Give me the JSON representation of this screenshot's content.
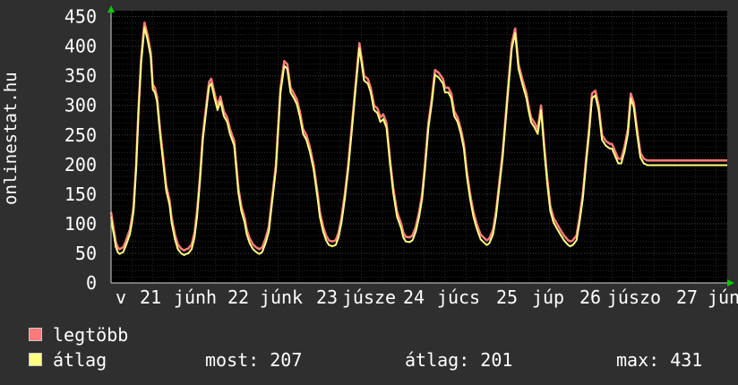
{
  "ylabel": "onlinestat.hu",
  "colors": {
    "background": "#2f2f2f",
    "plot": "#000000",
    "grid": "#5a5a5a",
    "max": "#ff7a7a",
    "avg": "#ffff80",
    "axis_arrow": "#00cc00"
  },
  "legend": {
    "max_label": "legtöbb",
    "avg_label": "átlag"
  },
  "stats": {
    "now": "most: 207",
    "avg": "átlag: 201",
    "max": "max: 431"
  },
  "chart_data": {
    "type": "line",
    "ylim": [
      0,
      460
    ],
    "yticks": [
      0,
      50,
      100,
      150,
      200,
      250,
      300,
      350,
      400,
      450
    ],
    "x_tick_labels": [
      "v",
      "21",
      "júnh",
      "22",
      "júnk",
      "23",
      "júsze",
      "24",
      "júcs",
      "25",
      "júp",
      "26",
      "júszo",
      "27",
      "jún"
    ],
    "series": [
      {
        "name": "legtöbb",
        "color": "#ff7a7a",
        "x": [
          0,
          0.04,
          0.09,
          0.11,
          0.16,
          0.2,
          0.29,
          0.35,
          0.45,
          0.5,
          0.54,
          0.6,
          0.66,
          0.72,
          0.8,
          0.87,
          0.95,
          1.0,
          1.05,
          1.1,
          1.18,
          1.25,
          1.32,
          1.4,
          1.45,
          1.53,
          1.6,
          1.68,
          1.75,
          1.8,
          1.85,
          1.93,
          2.0,
          2.06,
          2.13,
          2.2,
          2.28,
          2.35,
          2.4,
          2.48,
          2.55,
          2.62,
          2.7,
          2.78,
          2.85,
          2.95,
          3.0,
          3.05,
          3.12,
          3.2,
          3.25,
          3.32,
          3.4,
          3.48,
          3.55,
          3.62,
          3.7,
          3.78,
          3.85,
          3.95,
          4.0,
          4.06,
          4.15,
          4.22,
          4.3,
          4.38,
          4.45,
          4.52,
          4.6,
          4.68,
          4.76,
          4.85,
          4.95,
          5.0,
          5.08,
          5.15,
          5.22,
          5.3,
          5.38,
          5.45,
          5.52,
          5.6,
          5.68,
          5.76,
          5.85,
          5.95,
          6.0,
          6.06,
          6.15,
          6.22,
          6.3,
          6.38,
          6.45,
          6.52,
          6.6,
          6.68,
          6.76,
          6.85,
          6.95,
          7.0,
          7.06,
          7.15,
          7.22,
          7.3,
          7.38,
          7.45,
          7.52,
          7.6,
          7.68,
          7.76,
          7.85,
          7.95,
          8.0,
          8.08,
          8.15,
          8.22,
          8.3,
          8.38,
          8.45,
          8.52,
          8.6,
          8.68,
          8.76,
          8.85,
          8.95,
          9.0,
          9.06,
          9.15,
          9.22,
          9.3,
          9.38,
          9.45,
          9.52,
          9.6,
          9.68,
          9.76,
          9.85,
          9.95,
          10.0,
          10.06,
          10.15,
          10.22,
          10.3,
          10.38,
          10.45,
          10.52,
          10.6,
          10.68,
          10.76,
          10.85,
          10.95,
          11.0,
          11.06,
          11.15,
          11.22,
          11.3,
          11.38,
          11.45,
          11.52,
          11.6,
          11.68,
          11.76,
          11.85,
          11.95,
          12.0,
          12.06,
          12.15,
          12.22,
          12.3,
          12.38,
          12.45,
          12.52,
          12.6,
          12.68,
          12.76,
          12.85,
          12.95,
          13.0,
          13.06,
          13.15,
          13.22,
          13.3,
          13.38,
          13.45,
          13.52,
          13.6,
          13.68,
          13.76,
          13.85,
          13.95,
          14.0,
          14.06,
          14.15,
          14.22,
          14.3,
          14.38,
          14.45,
          14.52,
          14.6,
          14.68,
          14.76
        ],
        "values": [
          120,
          100,
          80,
          70,
          60,
          57,
          60,
          70,
          90,
          110,
          130,
          200,
          300,
          380,
          440,
          420,
          390,
          335,
          330,
          315,
          255,
          210,
          165,
          140,
          110,
          82,
          65,
          58,
          55,
          57,
          58,
          65,
          85,
          120,
          180,
          250,
          300,
          340,
          345,
          320,
          300,
          315,
          290,
          280,
          260,
          240,
          200,
          160,
          130,
          110,
          90,
          75,
          65,
          60,
          57,
          60,
          75,
          95,
          140,
          200,
          260,
          330,
          375,
          370,
          330,
          320,
          310,
          290,
          260,
          250,
          230,
          200,
          150,
          120,
          95,
          80,
          72,
          70,
          72,
          85,
          110,
          150,
          200,
          260,
          330,
          405,
          380,
          350,
          345,
          330,
          300,
          295,
          280,
          285,
          270,
          210,
          160,
          120,
          100,
          85,
          78,
          77,
          80,
          95,
          120,
          150,
          200,
          270,
          310,
          360,
          355,
          345,
          330,
          330,
          320,
          290,
          280,
          260,
          235,
          190,
          150,
          120,
          100,
          82,
          75,
          72,
          75,
          90,
          120,
          170,
          220,
          280,
          340,
          405,
          430,
          370,
          345,
          320,
          300,
          280,
          270,
          260,
          300,
          230,
          175,
          130,
          110,
          100,
          90,
          80,
          72,
          70,
          72,
          80,
          110,
          150,
          210,
          260,
          320,
          325,
          300,
          250,
          240,
          235,
          235,
          225,
          210,
          210,
          230,
          260,
          320,
          305,
          260,
          220,
          210,
          207,
          207,
          207,
          207,
          207,
          207,
          207,
          207,
          207,
          207,
          207,
          207,
          207,
          207,
          207,
          207,
          207,
          207,
          207,
          207,
          207,
          207,
          207,
          207,
          207,
          207
        ]
      },
      {
        "name": "átlag",
        "color": "#ffff80",
        "values_offset": -8
      }
    ]
  }
}
